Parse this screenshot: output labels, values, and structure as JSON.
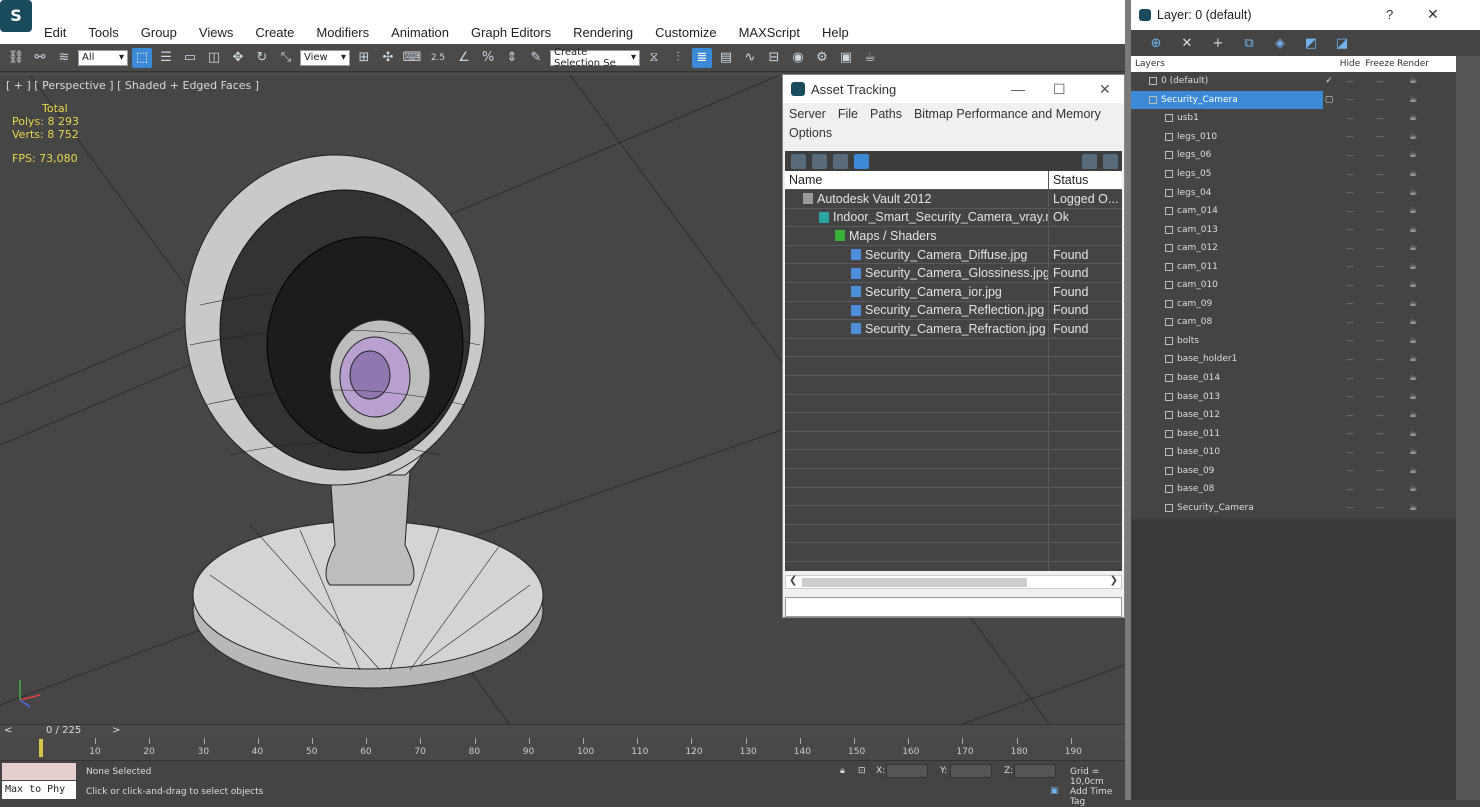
{
  "menu": [
    "Edit",
    "Tools",
    "Group",
    "Views",
    "Create",
    "Modifiers",
    "Animation",
    "Graph Editors",
    "Rendering",
    "Customize",
    "MAXScript",
    "Help"
  ],
  "toolbar": {
    "filter_value": "All",
    "refcoord_value": "View",
    "selection_set_placeholder": "Create Selection Se",
    "snap_label": "2.5"
  },
  "viewport": {
    "label": "[ + ] [ Perspective ] [ Shaded + Edged Faces ]",
    "stats_header": "Total",
    "polys": "Polys: 8 293",
    "verts": "Verts: 8 752",
    "fps": "FPS:   73,080"
  },
  "asset_tracking": {
    "title": "Asset Tracking",
    "menu": [
      "Server",
      "File",
      "Paths",
      "Bitmap Performance and Memory",
      "Options"
    ],
    "columns": {
      "name": "Name",
      "status": "Status"
    },
    "rows": [
      {
        "name": "Autodesk Vault 2012",
        "status": "Logged O...",
        "indent": 18,
        "icon": "vault-icon",
        "color": "#9a9a9a"
      },
      {
        "name": "Indoor_Smart_Security_Camera_vray.max",
        "status": "Ok",
        "indent": 34,
        "icon": "max-file-icon",
        "color": "#2aa3a3"
      },
      {
        "name": "Maps / Shaders",
        "status": "",
        "indent": 50,
        "icon": "maps-folder-icon",
        "color": "#3ab03a"
      },
      {
        "name": "Security_Camera_Diffuse.jpg",
        "status": "Found",
        "indent": 66,
        "icon": "image-file-icon",
        "color": "#4d8ed9"
      },
      {
        "name": "Security_Camera_Glossiness.jpg",
        "status": "Found",
        "indent": 66,
        "icon": "image-file-icon",
        "color": "#4d8ed9"
      },
      {
        "name": "Security_Camera_ior.jpg",
        "status": "Found",
        "indent": 66,
        "icon": "image-file-icon",
        "color": "#4d8ed9"
      },
      {
        "name": "Security_Camera_Reflection.jpg",
        "status": "Found",
        "indent": 66,
        "icon": "image-file-icon",
        "color": "#4d8ed9"
      },
      {
        "name": "Security_Camera_Refraction.jpg",
        "status": "Found",
        "indent": 66,
        "icon": "image-file-icon",
        "color": "#4d8ed9"
      }
    ],
    "empty_rows": 13
  },
  "layers": {
    "title": "Layer: 0 (default)",
    "help": "?",
    "columns": {
      "name": "Layers",
      "hide": "Hide",
      "freeze": "Freeze",
      "render": "Render"
    },
    "rows": [
      {
        "name": "0 (default)",
        "indent": 18,
        "current": true,
        "selected": false,
        "kind": "layer"
      },
      {
        "name": "Security_Camera",
        "indent": 18,
        "current": false,
        "selected": true,
        "kind": "layer"
      },
      {
        "name": "usb1",
        "indent": 34,
        "selected": false,
        "kind": "object"
      },
      {
        "name": "legs_010",
        "indent": 34,
        "selected": false,
        "kind": "object"
      },
      {
        "name": "legs_06",
        "indent": 34,
        "selected": false,
        "kind": "object"
      },
      {
        "name": "legs_05",
        "indent": 34,
        "selected": false,
        "kind": "object"
      },
      {
        "name": "legs_04",
        "indent": 34,
        "selected": false,
        "kind": "object"
      },
      {
        "name": "cam_014",
        "indent": 34,
        "selected": false,
        "kind": "object"
      },
      {
        "name": "cam_013",
        "indent": 34,
        "selected": false,
        "kind": "object"
      },
      {
        "name": "cam_012",
        "indent": 34,
        "selected": false,
        "kind": "object"
      },
      {
        "name": "cam_011",
        "indent": 34,
        "selected": false,
        "kind": "object"
      },
      {
        "name": "cam_010",
        "indent": 34,
        "selected": false,
        "kind": "object"
      },
      {
        "name": "cam_09",
        "indent": 34,
        "selected": false,
        "kind": "object"
      },
      {
        "name": "cam_08",
        "indent": 34,
        "selected": false,
        "kind": "object"
      },
      {
        "name": "bolts",
        "indent": 34,
        "selected": false,
        "kind": "object"
      },
      {
        "name": "base_holder1",
        "indent": 34,
        "selected": false,
        "kind": "object"
      },
      {
        "name": "base_014",
        "indent": 34,
        "selected": false,
        "kind": "object"
      },
      {
        "name": "base_013",
        "indent": 34,
        "selected": false,
        "kind": "object"
      },
      {
        "name": "base_012",
        "indent": 34,
        "selected": false,
        "kind": "object"
      },
      {
        "name": "base_011",
        "indent": 34,
        "selected": false,
        "kind": "object"
      },
      {
        "name": "base_010",
        "indent": 34,
        "selected": false,
        "kind": "object"
      },
      {
        "name": "base_09",
        "indent": 34,
        "selected": false,
        "kind": "object"
      },
      {
        "name": "base_08",
        "indent": 34,
        "selected": false,
        "kind": "object"
      },
      {
        "name": "Security_Camera",
        "indent": 34,
        "selected": false,
        "kind": "object"
      }
    ]
  },
  "timeline": {
    "counter": "0 / 225",
    "ticks": [
      10,
      20,
      30,
      40,
      50,
      60,
      70,
      80,
      90,
      100,
      110,
      120,
      130,
      140,
      150,
      160,
      170,
      180,
      190
    ]
  },
  "status": {
    "maxscript": "Max to Phy",
    "selection": "None Selected",
    "hint": "Click or click-and-drag to select objects",
    "x_label": "X:",
    "y_label": "Y:",
    "z_label": "Z:",
    "grid": "Grid = 10,0cm",
    "add_time_tag": "Add Time Tag"
  },
  "colors": {
    "accent": "#3c8ad6",
    "stats": "#e6d84a",
    "viewport_bg": "#464646"
  }
}
